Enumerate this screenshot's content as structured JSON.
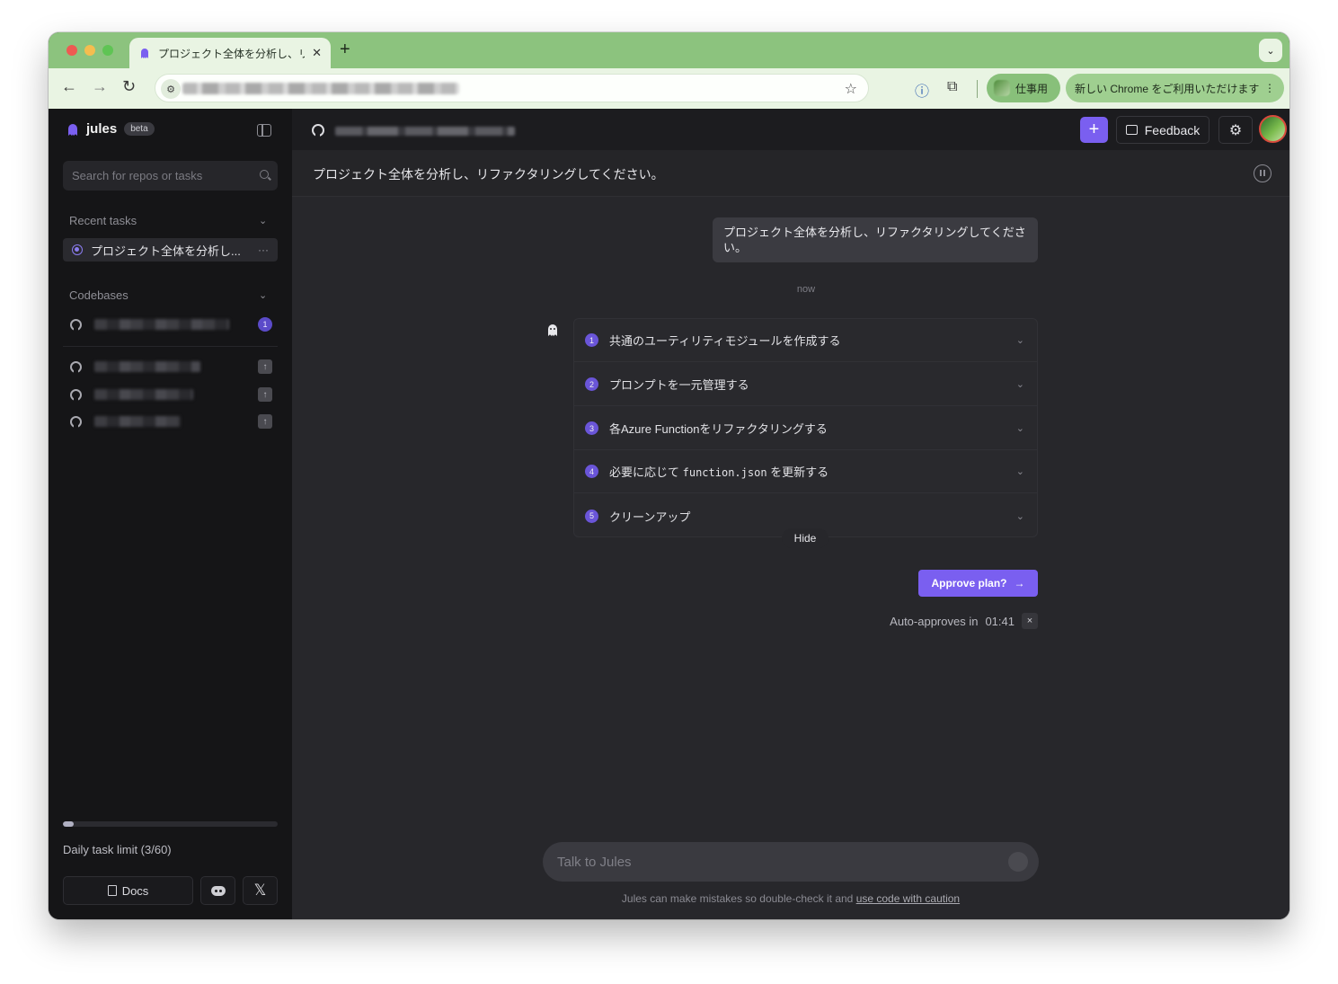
{
  "browser": {
    "tab_title": "プロジェクト全体を分析し、リフ",
    "new_tab": "+",
    "tab_menu": "⌄",
    "profile_label": "仕事用",
    "update_label": "新しい Chrome をご利用いただけます",
    "update_menu": "⋮"
  },
  "sidebar": {
    "app_name": "jules",
    "badge": "beta",
    "search_placeholder": "Search for repos or tasks",
    "recent_tasks_title": "Recent tasks",
    "recent_tasks": [
      {
        "label": "プロジェクト全体を分析し...",
        "more": "···"
      }
    ],
    "codebases_title": "Codebases",
    "codebases": [
      {
        "badge": "1"
      },
      {
        "badge": "↑"
      },
      {
        "badge": "↑"
      },
      {
        "badge": "↑"
      }
    ],
    "daily_limit": {
      "label": "Daily task limit (3/60)",
      "used": 3,
      "total": 60
    },
    "docs_label": "Docs",
    "x_label": "𝕏"
  },
  "topbar": {
    "new_button": "+",
    "feedback_label": "Feedback",
    "settings_icon": "⚙"
  },
  "task": {
    "title": "プロジェクト全体を分析し、リファクタリングしてください。",
    "user_message": "プロジェクト全体を分析し、リファクタリングしてください。",
    "timestamp": "now"
  },
  "plan": {
    "steps": [
      {
        "num": "1",
        "label": "共通のユーティリティモジュールを作成する"
      },
      {
        "num": "2",
        "label": "プロンプトを一元管理する"
      },
      {
        "num": "3",
        "label": "各Azure Functionをリファクタリングする"
      },
      {
        "num": "4",
        "label_prefix": "必要に応じて ",
        "label_code": "function.json",
        "label_suffix": " を更新する"
      },
      {
        "num": "5",
        "label": "クリーンアップ"
      }
    ],
    "hide_label": "Hide",
    "approve_label": "Approve plan?",
    "auto_approve_label": "Auto-approves in",
    "auto_approve_time": "01:41",
    "auto_close": "×"
  },
  "chat": {
    "placeholder": "Talk to Jules",
    "disclaimer": "Jules can make mistakes so double-check it and ",
    "disclaimer_link": "use code with caution"
  },
  "colors": {
    "accent": "#7a5ff0",
    "tabbar": "#8cc37e",
    "sidebar_bg": "#151517",
    "main_bg": "#27272b"
  }
}
